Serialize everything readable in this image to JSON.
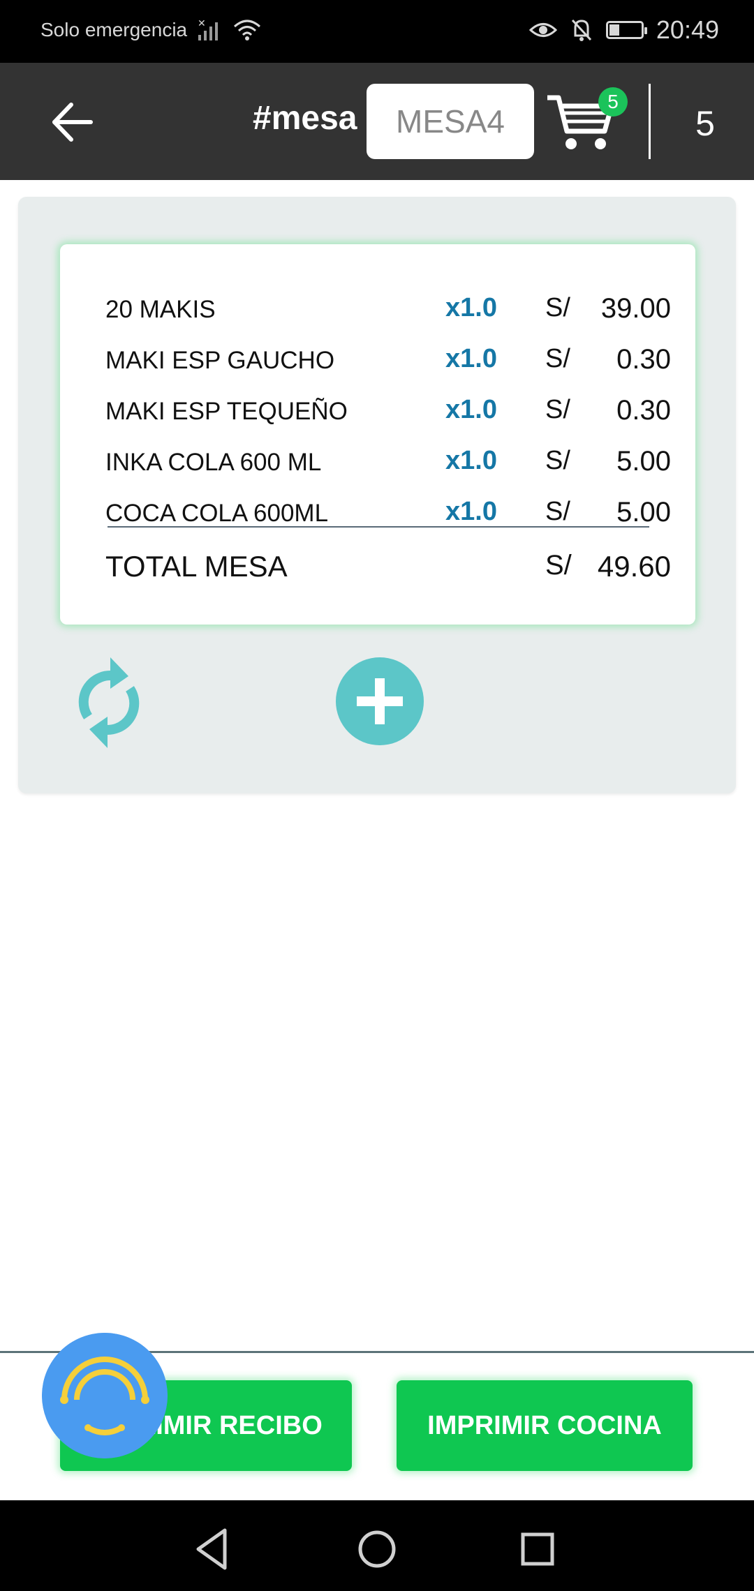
{
  "status_bar": {
    "carrier": "Solo emergencia",
    "time": "20:49"
  },
  "header": {
    "table_label": "#mesa",
    "table_value": "MESA4",
    "cart_badge": "5",
    "item_count": "5"
  },
  "order": {
    "items": [
      {
        "name": "20 MAKIS",
        "qty": "x1.0",
        "currency": "S/",
        "price": "39.00"
      },
      {
        "name": "MAKI ESP GAUCHO",
        "qty": "x1.0",
        "currency": "S/",
        "price": "0.30"
      },
      {
        "name": "MAKI ESP TEQUEÑO",
        "qty": "x1.0",
        "currency": "S/",
        "price": "0.30"
      },
      {
        "name": "INKA COLA 600 ML",
        "qty": "x1.0",
        "currency": "S/",
        "price": "5.00"
      },
      {
        "name": "COCA COLA 600ML",
        "qty": "x1.0",
        "currency": "S/",
        "price": "5.00"
      }
    ],
    "total_label": "TOTAL MESA",
    "total_currency": "S/",
    "total_value": "49.60"
  },
  "buttons": {
    "print_receipt": "IMPRIMIR RECIBO",
    "print_kitchen": "IMPRIMIR COCINA"
  },
  "colors": {
    "header_bg": "#333333",
    "accent_green": "#0fc751",
    "qty_blue": "#1577a6",
    "teal": "#5cc6c8",
    "fab_blue": "#4a9bf0",
    "fab_yellow": "#f5cf3a"
  }
}
